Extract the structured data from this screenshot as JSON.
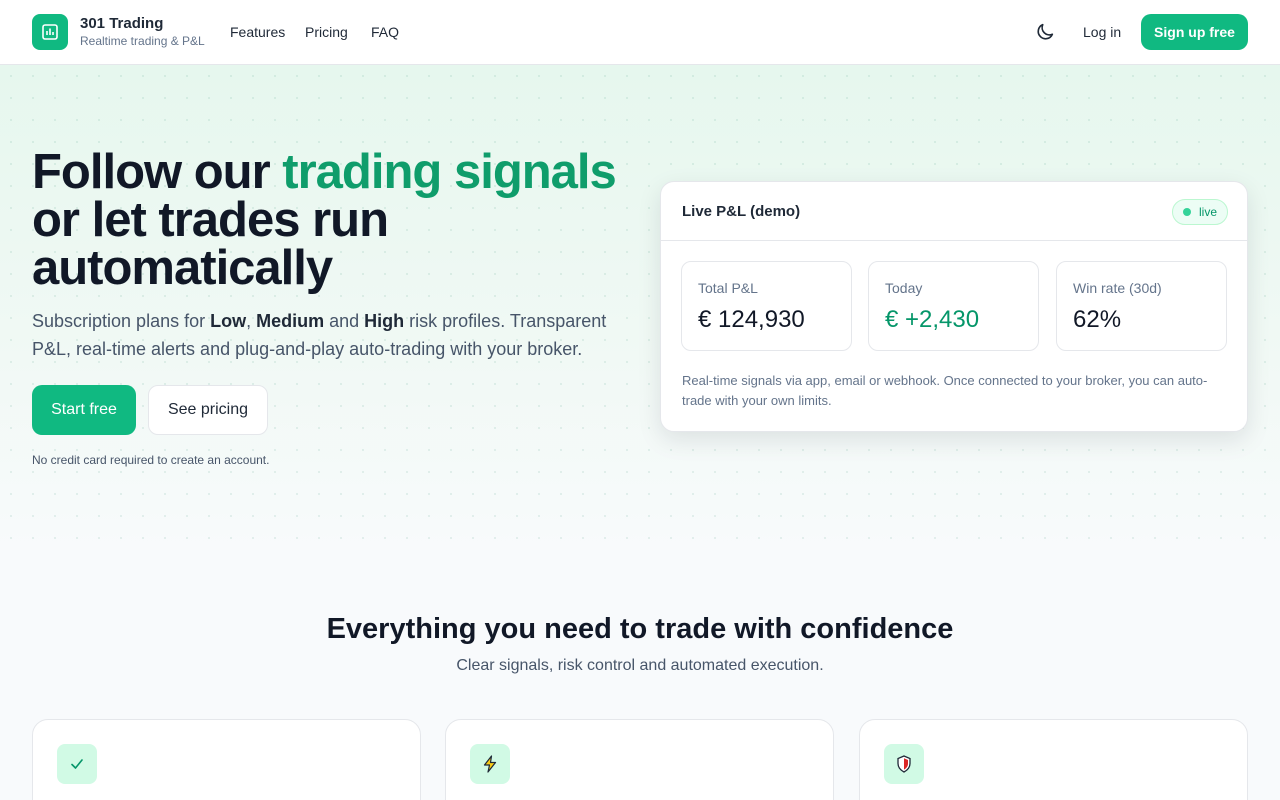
{
  "header": {
    "brand_name": "301 Trading",
    "brand_tagline": "Realtime trading & P&L",
    "nav": [
      "Features",
      "Pricing",
      "FAQ"
    ],
    "login_label": "Log in",
    "signup_label": "Sign up free"
  },
  "hero": {
    "title_part1": "Follow our ",
    "title_accent": "trading signals",
    "title_part2": " or let trades run automatically",
    "subtitle_pre": "Subscription plans for ",
    "risk_low": "Low",
    "sep1": ", ",
    "risk_medium": "Medium",
    "sep2": " and ",
    "risk_high": "High",
    "subtitle_post": " risk profiles. Transparent P&L, real-time alerts and plug-and-play auto-trading with your broker.",
    "start_label": "Start free",
    "pricing_label": "See pricing",
    "note": "No credit card required to create an account."
  },
  "pnl_card": {
    "title": "Live P&L (demo)",
    "badge": "live",
    "stats": [
      {
        "label": "Total P&L",
        "value": "€ 124,930"
      },
      {
        "label": "Today",
        "value": "€ +2,430"
      },
      {
        "label": "Win rate (30d)",
        "value": "62%"
      }
    ],
    "description": "Real-time signals via app, email or webhook. Once connected to your broker, you can auto-trade with your own limits."
  },
  "features": {
    "title": "Everything you need to trade with confidence",
    "subtitle": "Clear signals, risk control and automated execution.",
    "icons": [
      "check-icon",
      "lightning-icon",
      "shield-icon"
    ]
  },
  "colors": {
    "accent": "#10b981",
    "accent_text": "#0f9d6b",
    "positive": "#059669"
  }
}
